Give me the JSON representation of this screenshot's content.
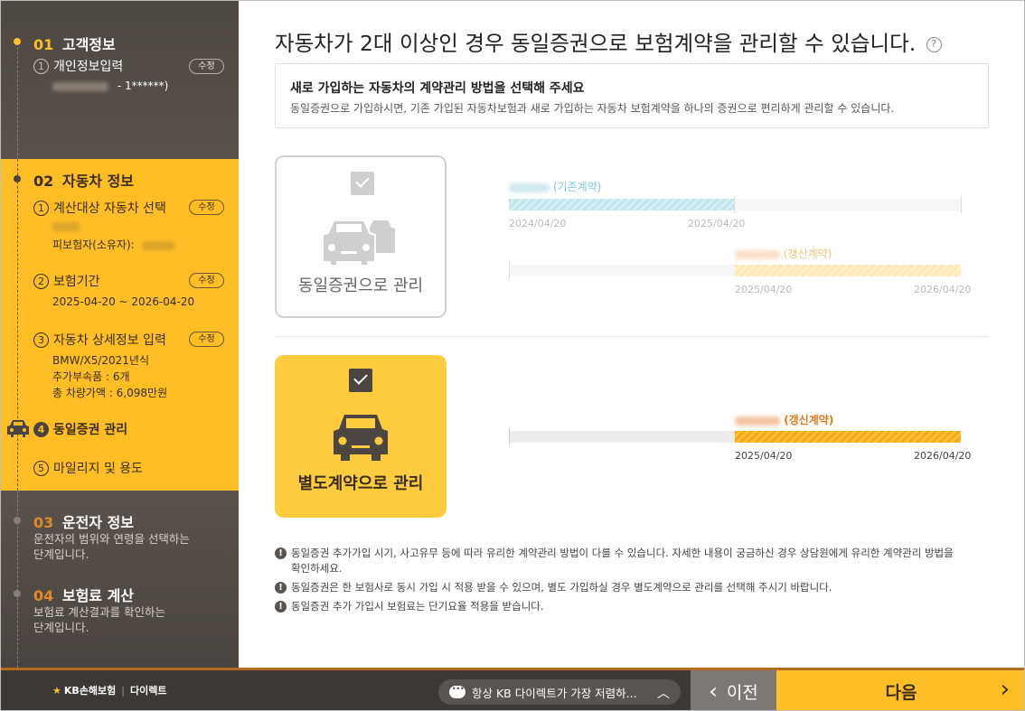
{
  "sidebar": {
    "step1": {
      "num": "01",
      "title": "고객정보",
      "sub1": {
        "num": "1",
        "label": "개인정보입력",
        "edit": "수정",
        "detail_suffix": "- 1******)"
      }
    },
    "step2": {
      "num": "02",
      "title": "자동차 정보",
      "sub1": {
        "num": "1",
        "label": "계산대상 자동차 선택",
        "edit": "수정",
        "detail_label": "피보험자(소유자):"
      },
      "sub2": {
        "num": "2",
        "label": "보험기간",
        "edit": "수정",
        "detail": "2025-04-20 ~ 2026-04-20"
      },
      "sub3": {
        "num": "3",
        "label": "자동차 상세정보 입력",
        "edit": "수정",
        "detail1": "BMW/X5/2021년식",
        "detail2": "추가부속품 : 6개",
        "detail3": "총 차량가액 : 6,098만원"
      },
      "sub4": {
        "num": "4",
        "label": "동일증권 관리"
      },
      "sub5": {
        "num": "5",
        "label": "마일리지 및 용도"
      }
    },
    "step3": {
      "num": "03",
      "title": "운전자 정보",
      "desc1": "운전자의 범위와 연령을 선택하는",
      "desc2": "단계입니다."
    },
    "step4": {
      "num": "04",
      "title": "보험료 계산",
      "desc1": "보험료 계산결과를 확인하는",
      "desc2": "단계입니다."
    }
  },
  "main": {
    "title": "자동차가 2대 이상인 경우 동일증권으로 보험계약을 관리할 수 있습니다.",
    "help_icon": "?",
    "notice": {
      "heading": "새로 가입하는 자동차의 계약관리 방법을 선택해 주세요",
      "text": "동일증권으로 가입하시면, 기존 가입된 자동차보험과 새로 가입하는 자동차 보험계약을 하나의 증권으로 편리하게 관리할 수 있습니다."
    },
    "option1": {
      "label": "동일증권으로 관리",
      "existing_label": "(기존계약)",
      "existing_start": "2024/04/20",
      "existing_end": "2025/04/20",
      "renewal_label": "(갱신계약)",
      "renewal_start": "2025/04/20",
      "renewal_end": "2026/04/20"
    },
    "option2": {
      "label": "별도계약으로 관리",
      "renewal_label": "(갱신계약)",
      "renewal_start": "2025/04/20",
      "renewal_end": "2026/04/20"
    },
    "notes": [
      "동일증권 추가가입 시기, 사고유무 등에 따라 유리한 계약관리 방법이 다를 수 있습니다. 자세한 내용이 궁금하신 경우 상담원에게 유리한 계약관리 방법을 확인하세요.",
      "동일증권은 한 보험사로 동시 가입 시 적용 받을 수 있으며, 별도 가입하실 경우 별도계약으로 관리를 선택해 주시기 바랍니다.",
      "동일증권 추가 가입시 보험료는 단기요율 적용을 받습니다."
    ]
  },
  "footer": {
    "brand": "KB손해보험",
    "brand_sub": "다이렉트",
    "chat_text": "항상 KB 다이렉트가 가장 저렴하...",
    "prev_label": "이전",
    "next_label": "다음"
  },
  "colors": {
    "accent": "#ffbd26",
    "sidebar_bg": "#4a4440",
    "existing_bar": "#bfe6ec",
    "renewal_bar": "#ffe6b3",
    "selected_bar": "#f7a90f"
  }
}
